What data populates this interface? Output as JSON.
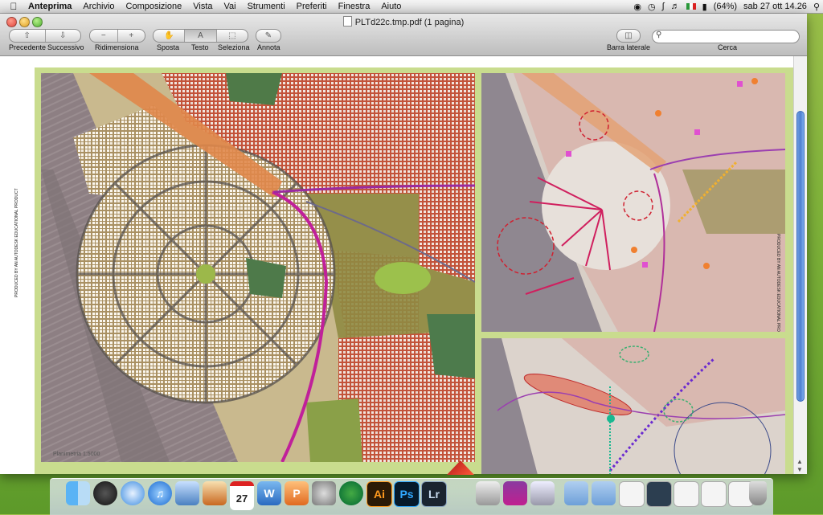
{
  "menubar": {
    "app_name": "Anteprima",
    "items": [
      "Archivio",
      "Composizione",
      "Vista",
      "Vai",
      "Strumenti",
      "Preferiti",
      "Finestra",
      "Aiuto"
    ],
    "battery": "(64%)",
    "datetime": "sab 27 ott  14.26"
  },
  "window": {
    "title": "PLTd22c.tmp.pdf (1 pagina)",
    "toolbar": {
      "prev_label": "Precedente",
      "next_label": "Successivo",
      "resize_label": "Ridimensiona",
      "move_label": "Sposta",
      "text_label": "Testo",
      "select_label": "Seleziona",
      "annotate_label": "Annota",
      "sidebar_label": "Barra laterale",
      "search_label": "Cerca",
      "search_value": ""
    }
  },
  "document": {
    "watermark": "PRODUCED BY AN AUTODESK EDUCATIONAL PRODUCT",
    "scale_label": "Planimetria 1:5000"
  },
  "dock": {
    "items": [
      "finder-icon",
      "dashboard-icon",
      "safari-icon",
      "itunes-icon",
      "photo-icon",
      "iphoto-icon",
      "ical-icon",
      "word-icon",
      "powerpoint-icon",
      "system-preferences-icon",
      "time-machine-icon",
      "illustrator-icon",
      "photoshop-icon",
      "lightroom-icon",
      "autocad-icon",
      "sketch-icon",
      "application-icon",
      "folder-icon",
      "folder-icon",
      "document-icon",
      "document-icon",
      "document-icon",
      "document-icon",
      "document-icon",
      "trash-icon"
    ],
    "labels": {
      "ical_day": "27",
      "ai": "Ai",
      "ps": "Ps",
      "lr": "Lr"
    }
  },
  "colors": {
    "accent": "#4f7fd0",
    "page_border": "#c9dc8e",
    "magenta_route": "#c0209a",
    "orange_corridor": "#e0874a"
  }
}
